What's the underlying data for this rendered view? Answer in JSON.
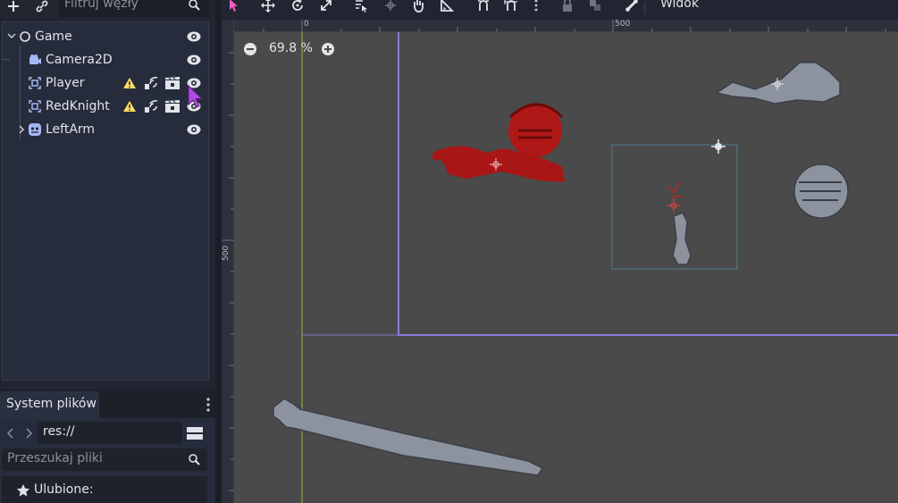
{
  "scene_panel": {
    "filter_placeholder": "Filtruj węzły",
    "nodes": [
      {
        "label": "Game",
        "icon": "node-icon",
        "visible": true
      },
      {
        "label": "Camera2D",
        "icon": "camera-icon",
        "visible": true
      },
      {
        "label": "Player",
        "icon": "skeleton-icon",
        "warning": true,
        "visible": true
      },
      {
        "label": "RedKnight",
        "icon": "skeleton-icon",
        "warning": true,
        "visible": true
      },
      {
        "label": "LeftArm",
        "icon": "sprite-icon",
        "collapsed": true,
        "visible": true
      }
    ]
  },
  "filesystem_panel": {
    "tab_label": "System plików",
    "path": "res://",
    "search_placeholder": "Przeszukaj pliki",
    "favorites_label": "Ulubione:"
  },
  "editor": {
    "view_menu": "Widok",
    "zoom_level": "69.8 %",
    "ruler_top_labels": [
      "0",
      "500"
    ],
    "ruler_left_labels": [
      "500"
    ]
  },
  "colors": {
    "accent": "#f55cc2",
    "viewport": "#4a4a4a",
    "boundary": "#8b7ad9",
    "red_knight": "#b01818",
    "knight_grey": "#8c939e"
  }
}
